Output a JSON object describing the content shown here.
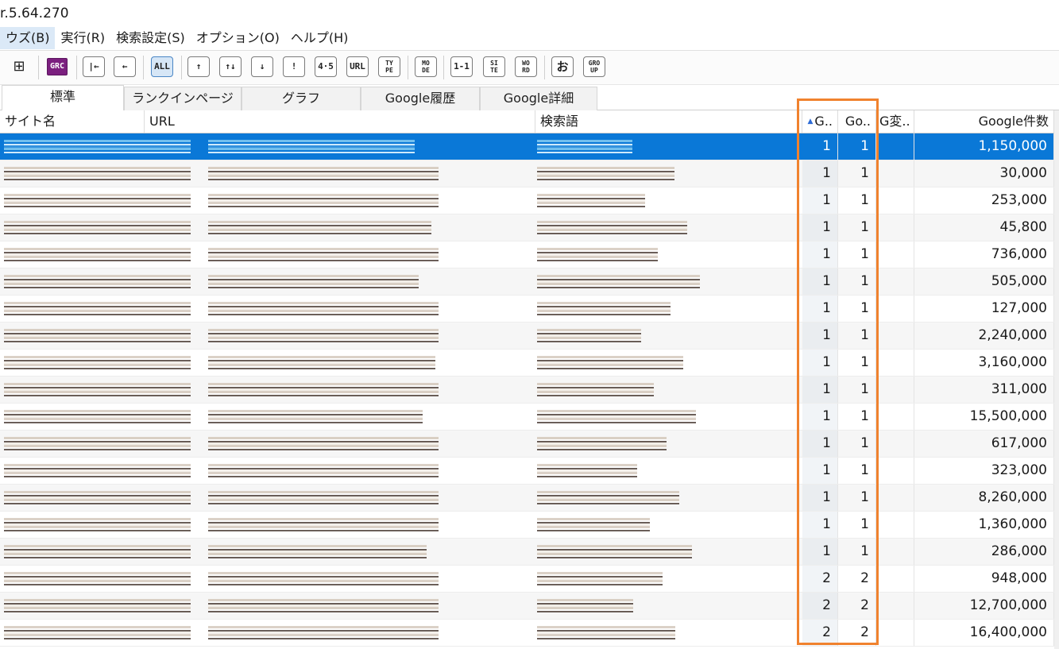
{
  "app": {
    "title": "r.5.64.270"
  },
  "menu": [
    {
      "label": "ウズ(B)",
      "active": true
    },
    {
      "label": "実行(R)",
      "active": false
    },
    {
      "label": "検索設定(S)",
      "active": false
    },
    {
      "label": "オプション(O)",
      "active": false
    },
    {
      "label": "ヘルプ(H)",
      "active": false
    }
  ],
  "toolbar": {
    "add_label": "⊞",
    "grc_label": "GRC",
    "first_label": "|←",
    "back_label": "←",
    "all_label": "ALL",
    "up_label": "↑",
    "updown_label": "↑↓",
    "down_label": "↓",
    "excl_label": "!",
    "num_label": "4·5",
    "url_label": "URL",
    "type_label": "TY\nPE",
    "mode_label": "MO\nDE",
    "one_label": "1-1",
    "site_label": "SI\nTE",
    "word_label": "WO\nRD",
    "o_label": "お",
    "group_label": "GRO\nUP"
  },
  "tabs": [
    {
      "label": "標準",
      "active": true
    },
    {
      "label": "ランクインページ",
      "active": false
    },
    {
      "label": "グラフ",
      "active": false
    },
    {
      "label": "Google履歴",
      "active": false
    },
    {
      "label": "Google詳細",
      "active": false
    }
  ],
  "columns": {
    "site": "サイト名",
    "url": "URL",
    "keyword": "検索語",
    "g": "G..",
    "go": "Go..",
    "gchange": "G変..",
    "count": "Google件数"
  },
  "rows": [
    {
      "g": "1",
      "go": "1",
      "count": "1,150,000",
      "selected": true
    },
    {
      "g": "1",
      "go": "1",
      "count": "30,000"
    },
    {
      "g": "1",
      "go": "1",
      "count": "253,000"
    },
    {
      "g": "1",
      "go": "1",
      "count": "45,800"
    },
    {
      "g": "1",
      "go": "1",
      "count": "736,000"
    },
    {
      "g": "1",
      "go": "1",
      "count": "505,000"
    },
    {
      "g": "1",
      "go": "1",
      "count": "127,000"
    },
    {
      "g": "1",
      "go": "1",
      "count": "2,240,000"
    },
    {
      "g": "1",
      "go": "1",
      "count": "3,160,000"
    },
    {
      "g": "1",
      "go": "1",
      "count": "311,000"
    },
    {
      "g": "1",
      "go": "1",
      "count": "15,500,000"
    },
    {
      "g": "1",
      "go": "1",
      "count": "617,000"
    },
    {
      "g": "1",
      "go": "1",
      "count": "323,000"
    },
    {
      "g": "1",
      "go": "1",
      "count": "8,260,000"
    },
    {
      "g": "1",
      "go": "1",
      "count": "1,360,000"
    },
    {
      "g": "1",
      "go": "1",
      "count": "286,000"
    },
    {
      "g": "2",
      "go": "2",
      "count": "948,000"
    },
    {
      "g": "2",
      "go": "2",
      "count": "12,700,000"
    },
    {
      "g": "2",
      "go": "2",
      "count": "16,400,000"
    }
  ],
  "colors": {
    "selected": "#0a78d7",
    "highlight": "#f0822e"
  }
}
